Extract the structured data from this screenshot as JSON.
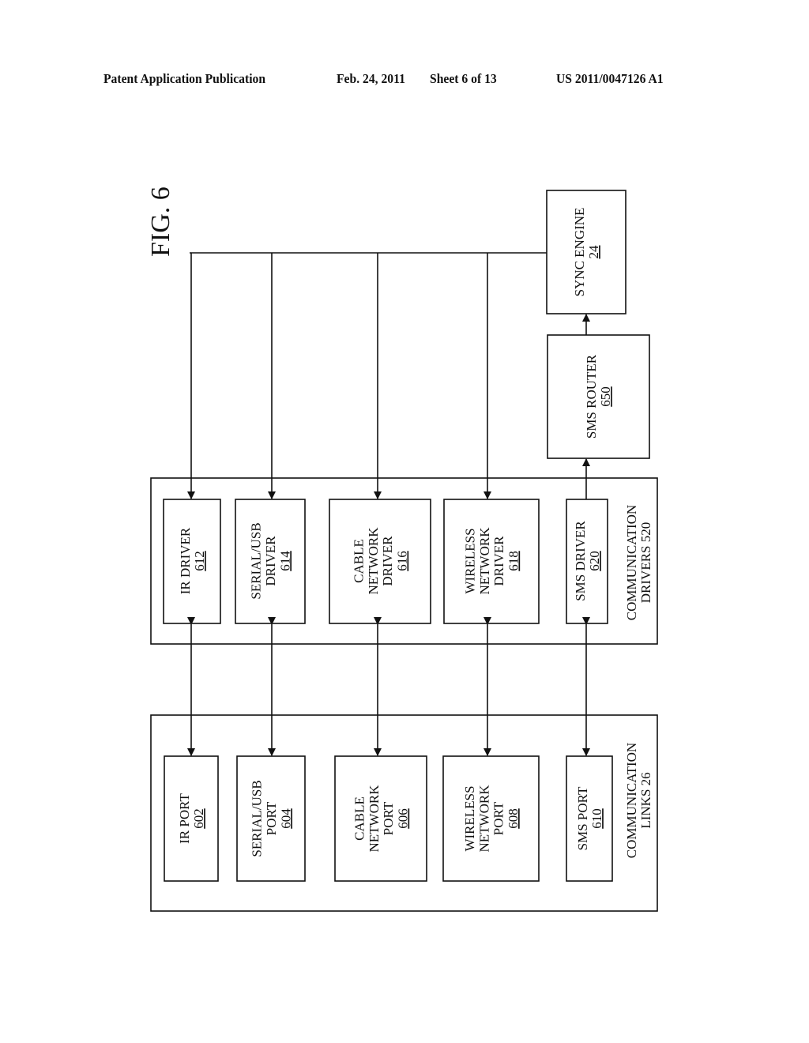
{
  "header": {
    "publication": "Patent Application Publication",
    "date": "Feb. 24, 2011",
    "sheet": "Sheet 6 of 13",
    "number": "US 2011/0047126 A1"
  },
  "figure": {
    "label": "FIG. 6",
    "sync_engine": {
      "lines": [
        "SYNC ENGINE"
      ],
      "ref": "24"
    },
    "sms_router": {
      "lines": [
        "SMS ROUTER"
      ],
      "ref": "650"
    },
    "drivers_group": {
      "lines": [
        "COMMUNICATION",
        "DRIVERS 520"
      ]
    },
    "links_group": {
      "lines": [
        "COMMUNICATION",
        "LINKS 26"
      ]
    },
    "drivers": [
      {
        "lines": [
          "IR DRIVER"
        ],
        "ref": "612"
      },
      {
        "lines": [
          "SERIAL/USB",
          "DRIVER"
        ],
        "ref": "614"
      },
      {
        "lines": [
          "CABLE",
          "NETWORK",
          "DRIVER"
        ],
        "ref": "616"
      },
      {
        "lines": [
          "WIRELESS",
          "NETWORK",
          "DRIVER"
        ],
        "ref": "618"
      },
      {
        "lines": [
          "SMS DRIVER"
        ],
        "ref": "620"
      }
    ],
    "ports": [
      {
        "lines": [
          "IR PORT"
        ],
        "ref": "602"
      },
      {
        "lines": [
          "SERIAL/USB",
          "PORT"
        ],
        "ref": "604"
      },
      {
        "lines": [
          "CABLE",
          "NETWORK",
          "PORT"
        ],
        "ref": "606"
      },
      {
        "lines": [
          "WIRELESS",
          "NETWORK",
          "PORT"
        ],
        "ref": "608"
      },
      {
        "lines": [
          "SMS PORT"
        ],
        "ref": "610"
      }
    ]
  }
}
